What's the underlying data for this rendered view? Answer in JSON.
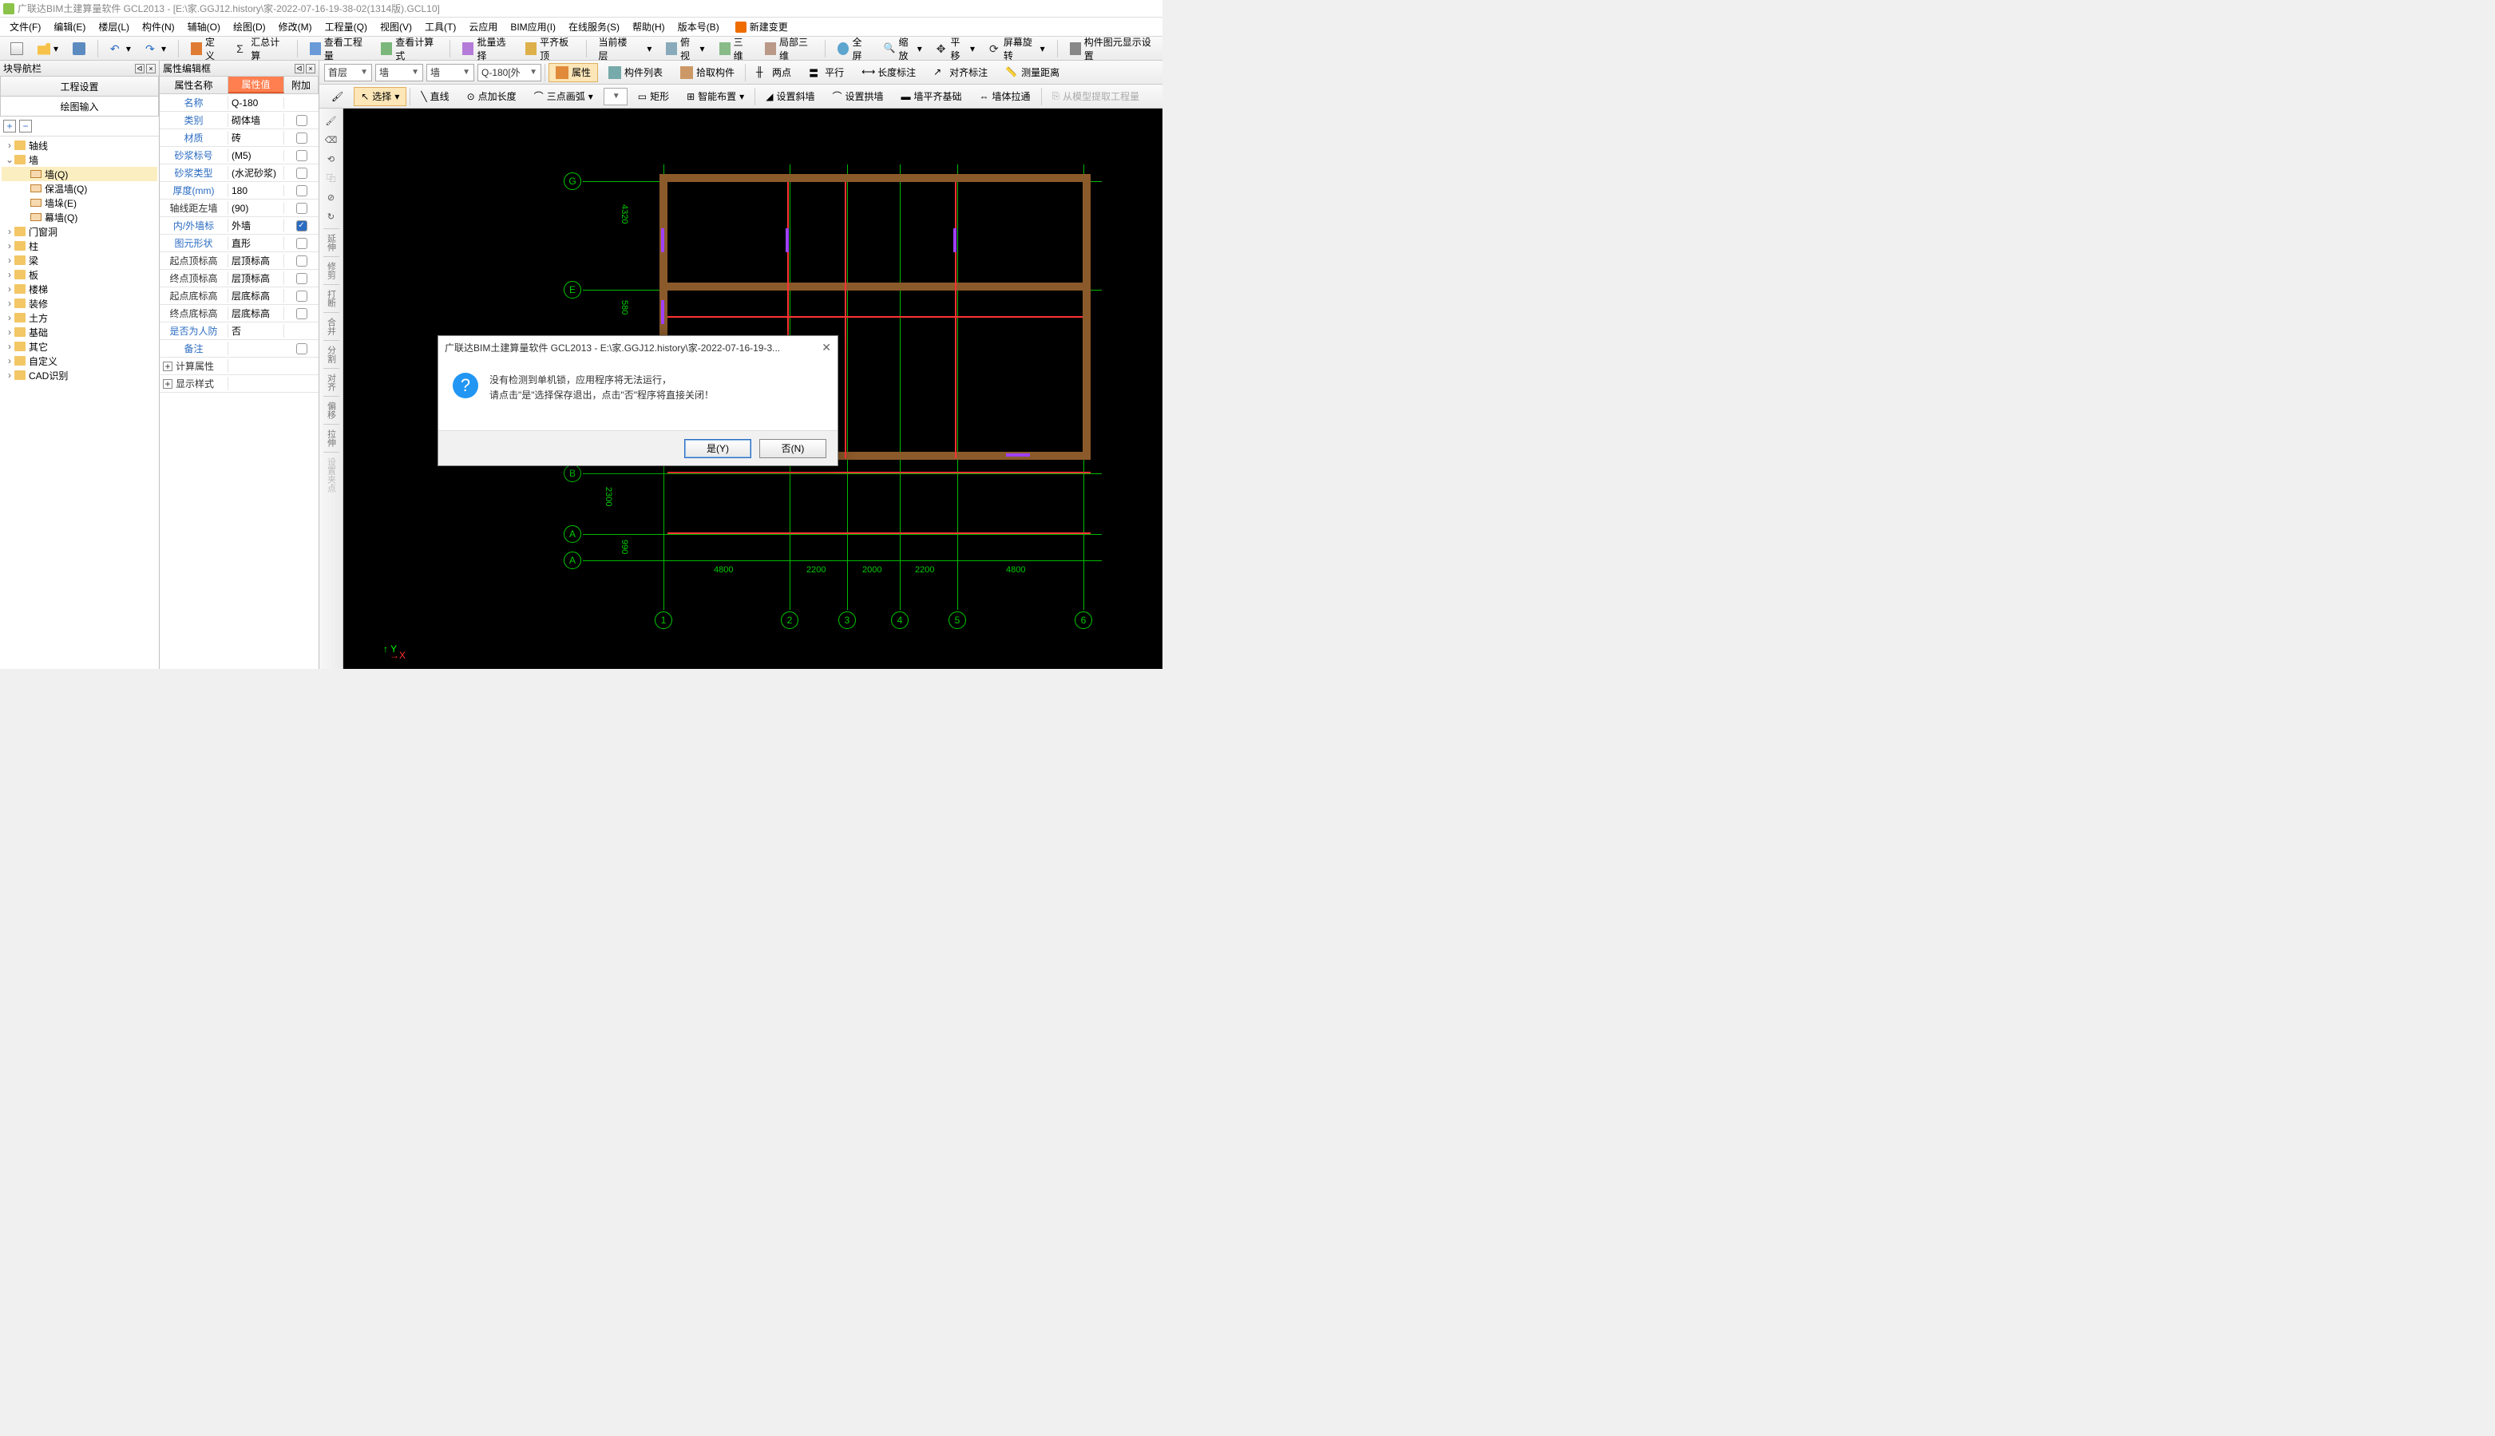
{
  "title": "广联达BIM土建算量软件 GCL2013 - [E:\\家.GGJ12.history\\家-2022-07-16-19-38-02(1314版).GCL10]",
  "menu": [
    "文件(F)",
    "编辑(E)",
    "楼层(L)",
    "构件(N)",
    "辅轴(O)",
    "绘图(D)",
    "修改(M)",
    "工程量(Q)",
    "视图(V)",
    "工具(T)",
    "云应用",
    "BIM应用(I)",
    "在线服务(S)",
    "帮助(H)",
    "版本号(B)"
  ],
  "newchange": "新建变更",
  "tb1": {
    "define": "定义",
    "sumcalc": "汇总计算",
    "viewqty": "查看工程量",
    "viewfmla": "查看计算式",
    "batch": "批量选择",
    "flat": "平齐板顶",
    "curfloor": "当前楼层",
    "bird": "俯视",
    "threeD": "三维",
    "local3d": "局部三维",
    "full": "全屏",
    "zoom": "缩放",
    "pan": "平移",
    "rotate": "屏幕旋转",
    "dispset": "构件图元显示设置"
  },
  "left": {
    "panel": "块导航栏",
    "tab1": "工程设置",
    "tab2": "绘图输入",
    "nodes": [
      {
        "l": "轴线",
        "lvl": 0,
        "fold": 1,
        "tw": ">"
      },
      {
        "l": "墙",
        "lvl": 0,
        "fold": 1,
        "tw": "v",
        "open": 1
      },
      {
        "l": "墙(Q)",
        "lvl": 2,
        "wic": 1,
        "sel": 1
      },
      {
        "l": "保温墙(Q)",
        "lvl": 2,
        "wic": 1
      },
      {
        "l": "墙垛(E)",
        "lvl": 2,
        "wic": 1
      },
      {
        "l": "幕墙(Q)",
        "lvl": 2,
        "wic": 1
      },
      {
        "l": "门窗洞",
        "lvl": 0,
        "fold": 1,
        "tw": ">"
      },
      {
        "l": "柱",
        "lvl": 0,
        "fold": 1,
        "tw": ">"
      },
      {
        "l": "梁",
        "lvl": 0,
        "fold": 1,
        "tw": ">"
      },
      {
        "l": "板",
        "lvl": 0,
        "fold": 1,
        "tw": ">"
      },
      {
        "l": "楼梯",
        "lvl": 0,
        "fold": 1,
        "tw": ">"
      },
      {
        "l": "装修",
        "lvl": 0,
        "fold": 1,
        "tw": ">"
      },
      {
        "l": "土方",
        "lvl": 0,
        "fold": 1,
        "tw": ">"
      },
      {
        "l": "基础",
        "lvl": 0,
        "fold": 1,
        "tw": ">"
      },
      {
        "l": "其它",
        "lvl": 0,
        "fold": 1,
        "tw": ">"
      },
      {
        "l": "自定义",
        "lvl": 0,
        "fold": 1,
        "tw": ">"
      },
      {
        "l": "CAD识别",
        "lvl": 0,
        "fold": 1,
        "tw": ">"
      }
    ]
  },
  "props": {
    "panel": "属性编辑框",
    "h1": "属性名称",
    "h2": "属性值",
    "h3": "附加",
    "rows": [
      {
        "n": "名称",
        "v": "Q-180",
        "blue": 1
      },
      {
        "n": "类别",
        "v": "砌体墙",
        "blue": 1,
        "chk": 0
      },
      {
        "n": "材质",
        "v": "砖",
        "blue": 1,
        "chk": 0
      },
      {
        "n": "砂浆标号",
        "v": "(M5)",
        "blue": 1,
        "chk": 0
      },
      {
        "n": "砂浆类型",
        "v": "(水泥砂浆)",
        "blue": 1,
        "chk": 0
      },
      {
        "n": "厚度(mm)",
        "v": "180",
        "blue": 1,
        "chk": 0
      },
      {
        "n": "轴线距左墙",
        "v": "(90)",
        "chk": 0
      },
      {
        "n": "内/外墙标",
        "v": "外墙",
        "blue": 1,
        "chk": 1
      },
      {
        "n": "图元形状",
        "v": "直形",
        "blue": 1,
        "chk": 0
      },
      {
        "n": "起点顶标高",
        "v": "层顶标高",
        "chk": 0
      },
      {
        "n": "终点顶标高",
        "v": "层顶标高",
        "chk": 0
      },
      {
        "n": "起点底标高",
        "v": "层底标高",
        "chk": 0
      },
      {
        "n": "终点底标高",
        "v": "层底标高",
        "chk": 0
      },
      {
        "n": "是否为人防",
        "v": "否",
        "blue": 1
      },
      {
        "n": "备注",
        "v": "",
        "blue": 1,
        "chk": 0
      }
    ],
    "exp1": "计算属性",
    "exp2": "显示样式"
  },
  "tb2": {
    "floor": "首层",
    "cat": "墙",
    "sub": "墙",
    "member": "Q-180[外",
    "attrs": "属性",
    "list": "构件列表",
    "pick": "拾取构件",
    "twopt": "两点",
    "parallel": "平行",
    "lendim": "长度标注",
    "aligndim": "对齐标注",
    "meas": "测量距离"
  },
  "tb3": {
    "select": "选择",
    "line": "直线",
    "ptlen": "点加长度",
    "arc3": "三点画弧",
    "rect": "矩形",
    "smart": "智能布置",
    "slope": "设置斜墙",
    "arch": "设置拱墙",
    "wallbase": "墙平齐基础",
    "wallpull": "墙体拉通",
    "extract": "从模型提取工程量"
  },
  "vtools": [
    "延伸",
    "修剪",
    "打断",
    "合并",
    "分割",
    "对齐",
    "偏移",
    "拉伸",
    "设置夹点"
  ],
  "dims": {
    "d1": "4320",
    "d2": "580",
    "d3": "2300",
    "d4": "990",
    "h1": "4800",
    "h2": "2200",
    "h3": "2000",
    "h4": "2200",
    "h5": "4800"
  },
  "axes": {
    "v": [
      "G",
      "E",
      "B",
      "A",
      "A"
    ],
    "h": [
      "1",
      "2",
      "3",
      "4",
      "5",
      "6"
    ]
  },
  "coord": {
    "y": "Y",
    "x": "X"
  },
  "dialog": {
    "title": "广联达BIM土建算量软件 GCL2013 - E:\\家.GGJ12.history\\家-2022-07-16-19-3...",
    "line1": "没有检测到单机锁，应用程序将无法运行，",
    "line2": "请点击\"是\"选择保存退出，点击\"否\"程序将直接关闭！",
    "yes": "是(Y)",
    "no": "否(N)"
  }
}
